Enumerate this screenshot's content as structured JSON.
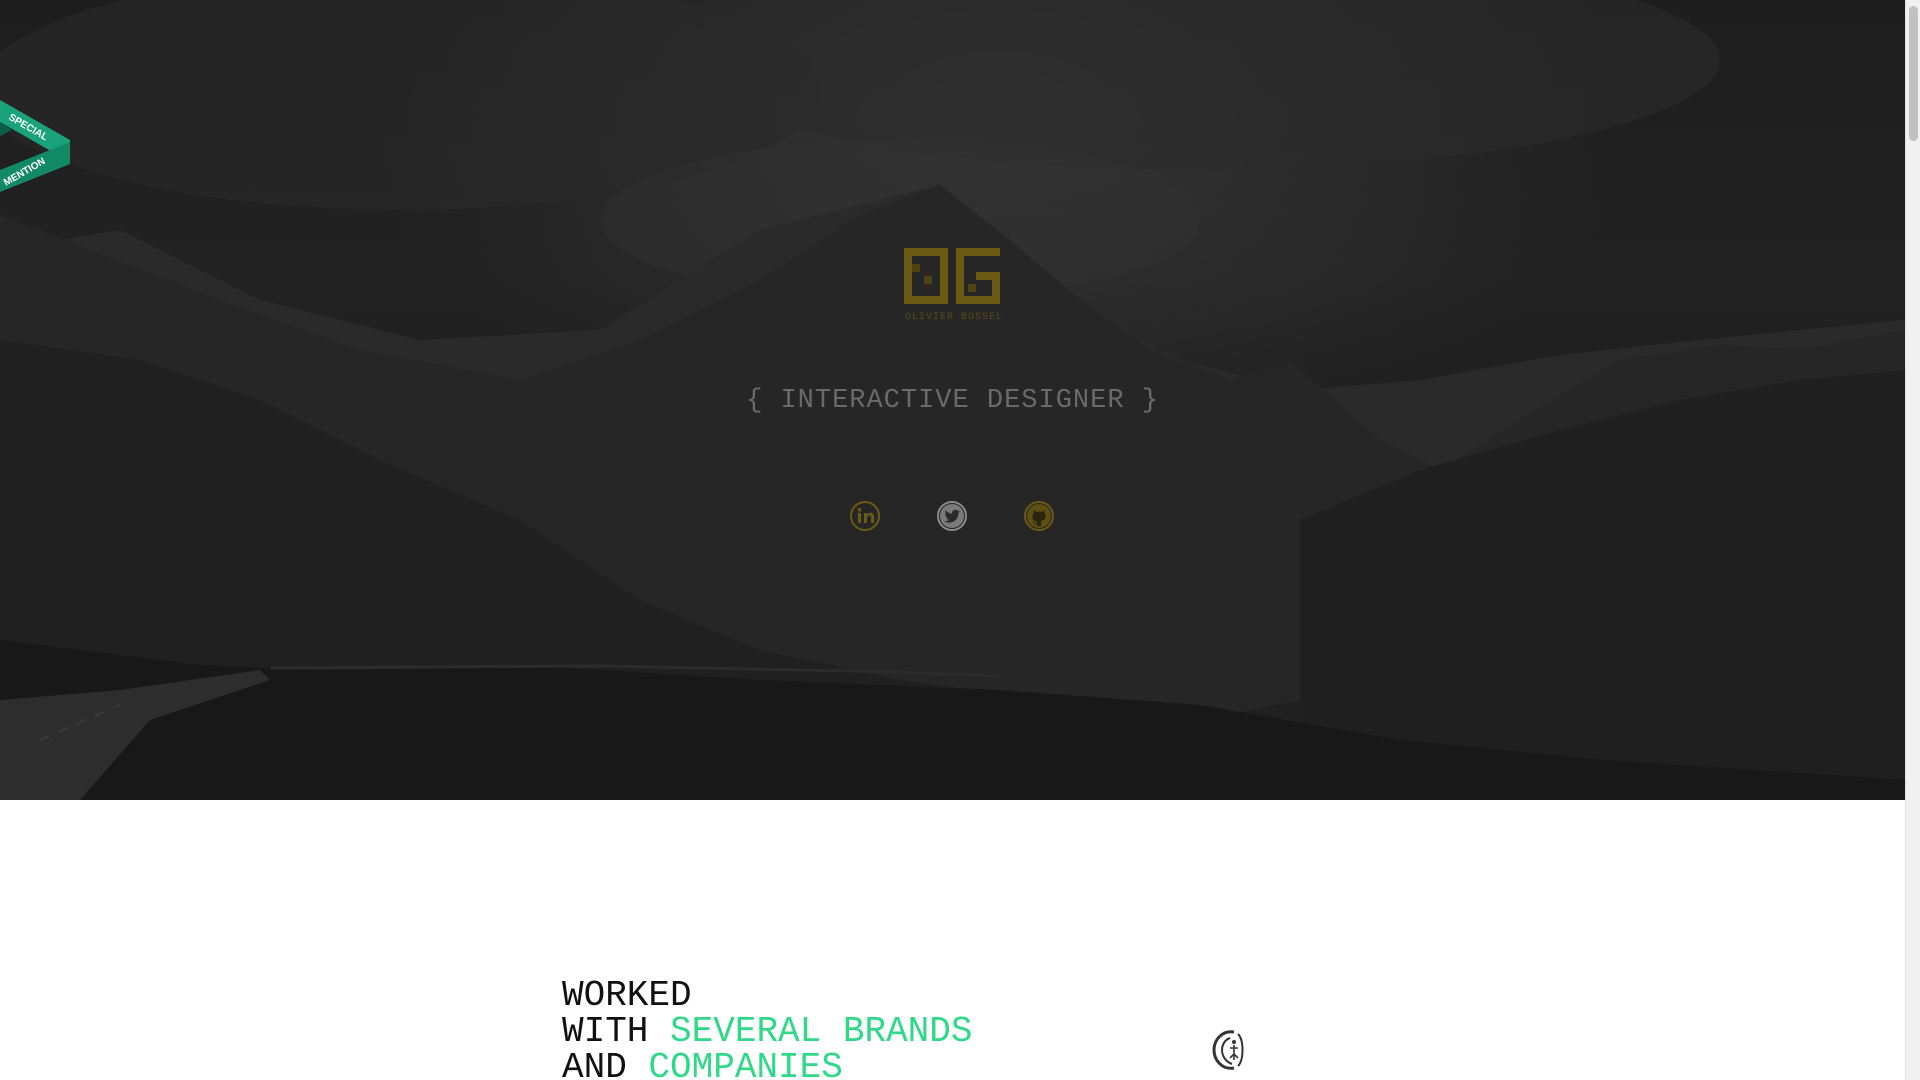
{
  "hero": {
    "logo_letters": "OG",
    "logo_subtitle": "OLIVIER BOSSEL",
    "tagline": "{ INTERACTIVE DESIGNER }",
    "social": [
      {
        "name": "LinkedIn",
        "icon": "linkedin-icon"
      },
      {
        "name": "Twitter",
        "icon": "twitter-icon"
      },
      {
        "name": "GitHub",
        "icon": "github-icon"
      }
    ]
  },
  "badge": {
    "line1": "SPECIAL",
    "line2": "MENTION"
  },
  "worked": {
    "line1": "WORKED",
    "line2_prefix": "WITH ",
    "line2_accent": "SEVERAL BRANDS",
    "line3_prefix": "AND ",
    "line3_accent": "COMPANIES"
  },
  "colors": {
    "accent": "#2fd987",
    "logo_gold": "#6b5a14",
    "hero_bg": "#1d1d1d"
  }
}
